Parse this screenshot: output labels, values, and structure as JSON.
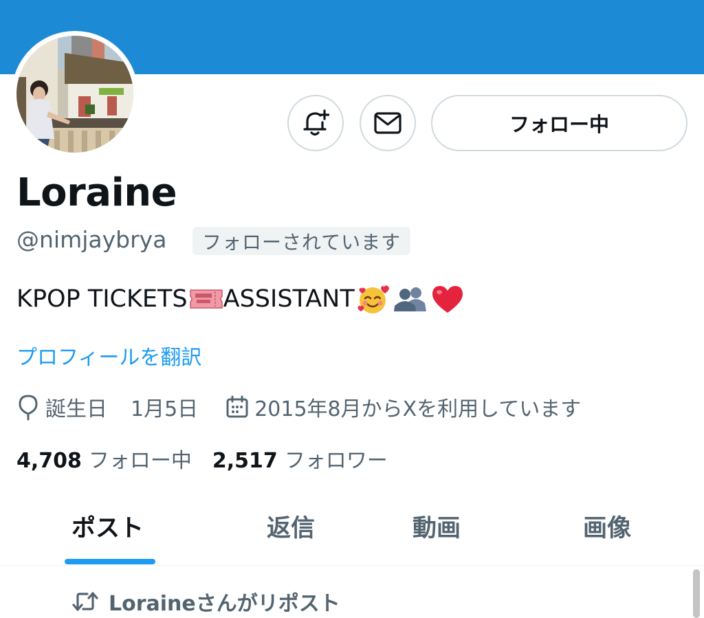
{
  "profile": {
    "display_name": "Loraine",
    "handle": "@nimjaybrya",
    "follows_you_badge": "フォローされています",
    "bio_text": "KPOP TICKETS",
    "bio_text_2": " ASSISTANT",
    "bio_emojis": [
      "ticket-emoji",
      "smiling-face-with-hearts-emoji",
      "silhouettes-emoji",
      "red-heart-emoji"
    ],
    "translate_link": "プロフィールを翻訳",
    "birthday_label": "誕生日",
    "birthday_value": "1月5日",
    "joined": "2015年8月からXを利用しています"
  },
  "actions": {
    "notify_icon": "bell-plus-icon",
    "message_icon": "mail-icon",
    "follow_label": "フォロー中"
  },
  "stats": {
    "following_count": "4,708",
    "following_label": "フォロー中",
    "followers_count": "2,517",
    "followers_label": "フォロワー"
  },
  "tabs": [
    {
      "label": "ポスト",
      "active": true
    },
    {
      "label": "返信",
      "active": false
    },
    {
      "label": "動画",
      "active": false
    },
    {
      "label": "画像",
      "active": false
    }
  ],
  "timeline": {
    "repost_text": "Loraineさんがリポスト"
  },
  "colors": {
    "banner": "#1d8ad6",
    "accent": "#1d9bf0",
    "secondary_text": "#536471",
    "primary_text": "#0f1419",
    "border": "#cfd9de"
  }
}
